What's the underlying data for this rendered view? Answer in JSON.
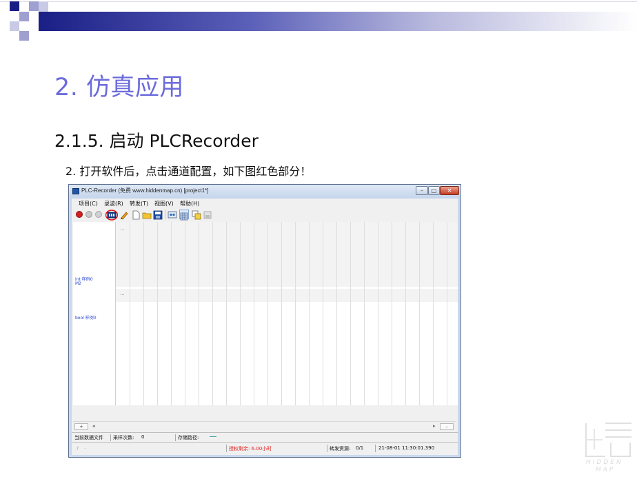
{
  "slide": {
    "title": "2. 仿真应用",
    "subtitle": "2.1.5. 启动 PLCRecorder",
    "step": "2. 打开软件后，点击通道配置，如下图红色部分！"
  },
  "window": {
    "title": "PLC-Recorder (免费 www.hiddenmap.cn) [project1*]",
    "buttons": {
      "minimize": "–",
      "maximize": "□",
      "close": "✕"
    }
  },
  "menu": [
    {
      "label": "项目(C)"
    },
    {
      "label": "录波(R)"
    },
    {
      "label": "转发(T)"
    },
    {
      "label": "视图(V)"
    },
    {
      "label": "帮助(H)"
    }
  ],
  "toolbar_icons": [
    "record-icon",
    "pause-icon",
    "stop-icon",
    "channel-config-icon",
    "pencil-icon",
    "new-file-icon",
    "open-folder-icon",
    "save-icon",
    "monitor-icon",
    "grid-icon",
    "copy-icon",
    "export-icon"
  ],
  "channels": [
    {
      "label": "int 样例0",
      "sublabel": "M2"
    },
    {
      "label": "bool 样例0"
    }
  ],
  "chart": {
    "ellipsis": "..."
  },
  "scroll": {
    "add": "+",
    "remove": "–",
    "left": "◂",
    "right": "▸"
  },
  "status": {
    "current_file_label": "当前数据文件",
    "sample_count_label": "采样次数:",
    "sample_count": "0",
    "storage_path_label": "存储路径:",
    "indicator": "┌",
    "dot": ".",
    "license": "授权剩余: 6.00小时",
    "forward_label": "转发资源:",
    "forward_value": "0/1",
    "datetime": "21-08-01 11:30:01.390"
  },
  "logo": {
    "text_line1": "HIDDEN",
    "text_line2": "MAP"
  },
  "colors": {
    "title": "#6b6bdc",
    "accent_bar": "#1a1f86",
    "license": "#e02020",
    "channel_label": "#2340d0"
  }
}
